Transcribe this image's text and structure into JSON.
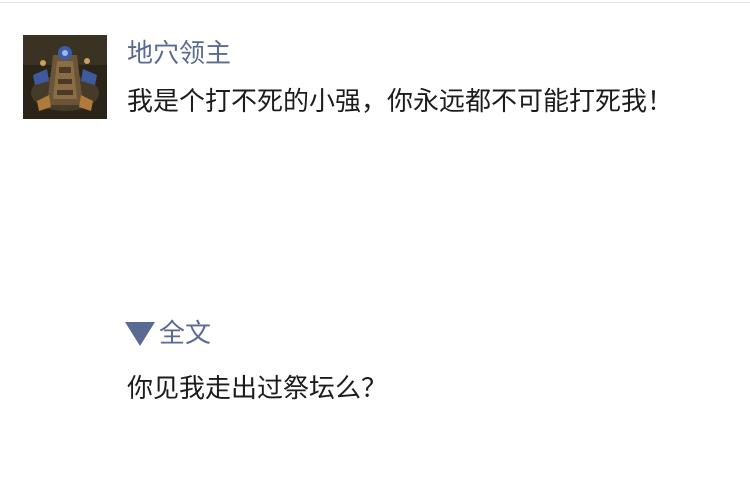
{
  "post": {
    "username": "地穴领主",
    "text": "我是个打不死的小强，你永远都不可能打死我！",
    "avatar_icon": "crypt-lord-avatar-icon"
  },
  "expand": {
    "icon": "triangle-down-icon",
    "label": "全文"
  },
  "reply": {
    "text": "你见我走出过祭坛么？"
  },
  "colors": {
    "link": "#5b6a92",
    "text": "#1c1c1c"
  }
}
